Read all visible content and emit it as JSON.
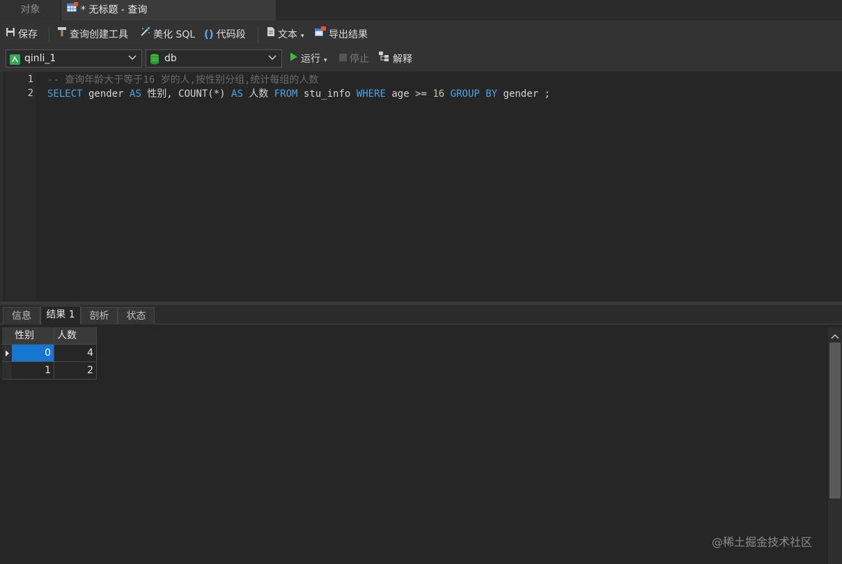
{
  "tabs": {
    "objects": "对象",
    "query": "* 无标题 - 查询"
  },
  "toolbar": {
    "save": "保存",
    "query_builder": "查询创建工具",
    "beautify_sql": "美化 SQL",
    "code_snippet": "代码段",
    "text": "文本",
    "export": "导出结果"
  },
  "toolbar2": {
    "connection": "qinli_1",
    "database": "db",
    "run": "运行",
    "stop": "停止",
    "explain": "解释"
  },
  "editor": {
    "line_numbers": [
      "1",
      "2"
    ],
    "line1": "-- 查询年龄大于等于16 岁的人,按性别分组,统计每组的人数",
    "line2_tokens": [
      {
        "t": "SELECT",
        "c": "kw"
      },
      {
        "t": " gender ",
        "c": "id"
      },
      {
        "t": "AS",
        "c": "kw"
      },
      {
        "t": " 性别, COUNT(*) ",
        "c": "id"
      },
      {
        "t": "AS",
        "c": "kw"
      },
      {
        "t": " 人数 ",
        "c": "id"
      },
      {
        "t": "FROM",
        "c": "kw"
      },
      {
        "t": " stu_info ",
        "c": "id"
      },
      {
        "t": "WHERE",
        "c": "kw"
      },
      {
        "t": " age >= ",
        "c": "id"
      },
      {
        "t": "16",
        "c": "num"
      },
      {
        "t": " ",
        "c": "id"
      },
      {
        "t": "GROUP BY",
        "c": "kw"
      },
      {
        "t": " gender ;",
        "c": "id"
      }
    ]
  },
  "result_tabs": [
    "信息",
    "结果 1",
    "剖析",
    "状态"
  ],
  "result_tab_active": "结果 1",
  "grid": {
    "columns": [
      "性别",
      "人数"
    ],
    "rows": [
      [
        "0",
        "4"
      ],
      [
        "1",
        "2"
      ]
    ]
  },
  "watermark": "@稀土掘金技术社区",
  "colors": {
    "keyword": "#4ea3e3",
    "comment": "#6a6a6a",
    "number": "#b5cea8",
    "selection": "#1677d2",
    "run_green": "#3dbb3d"
  }
}
